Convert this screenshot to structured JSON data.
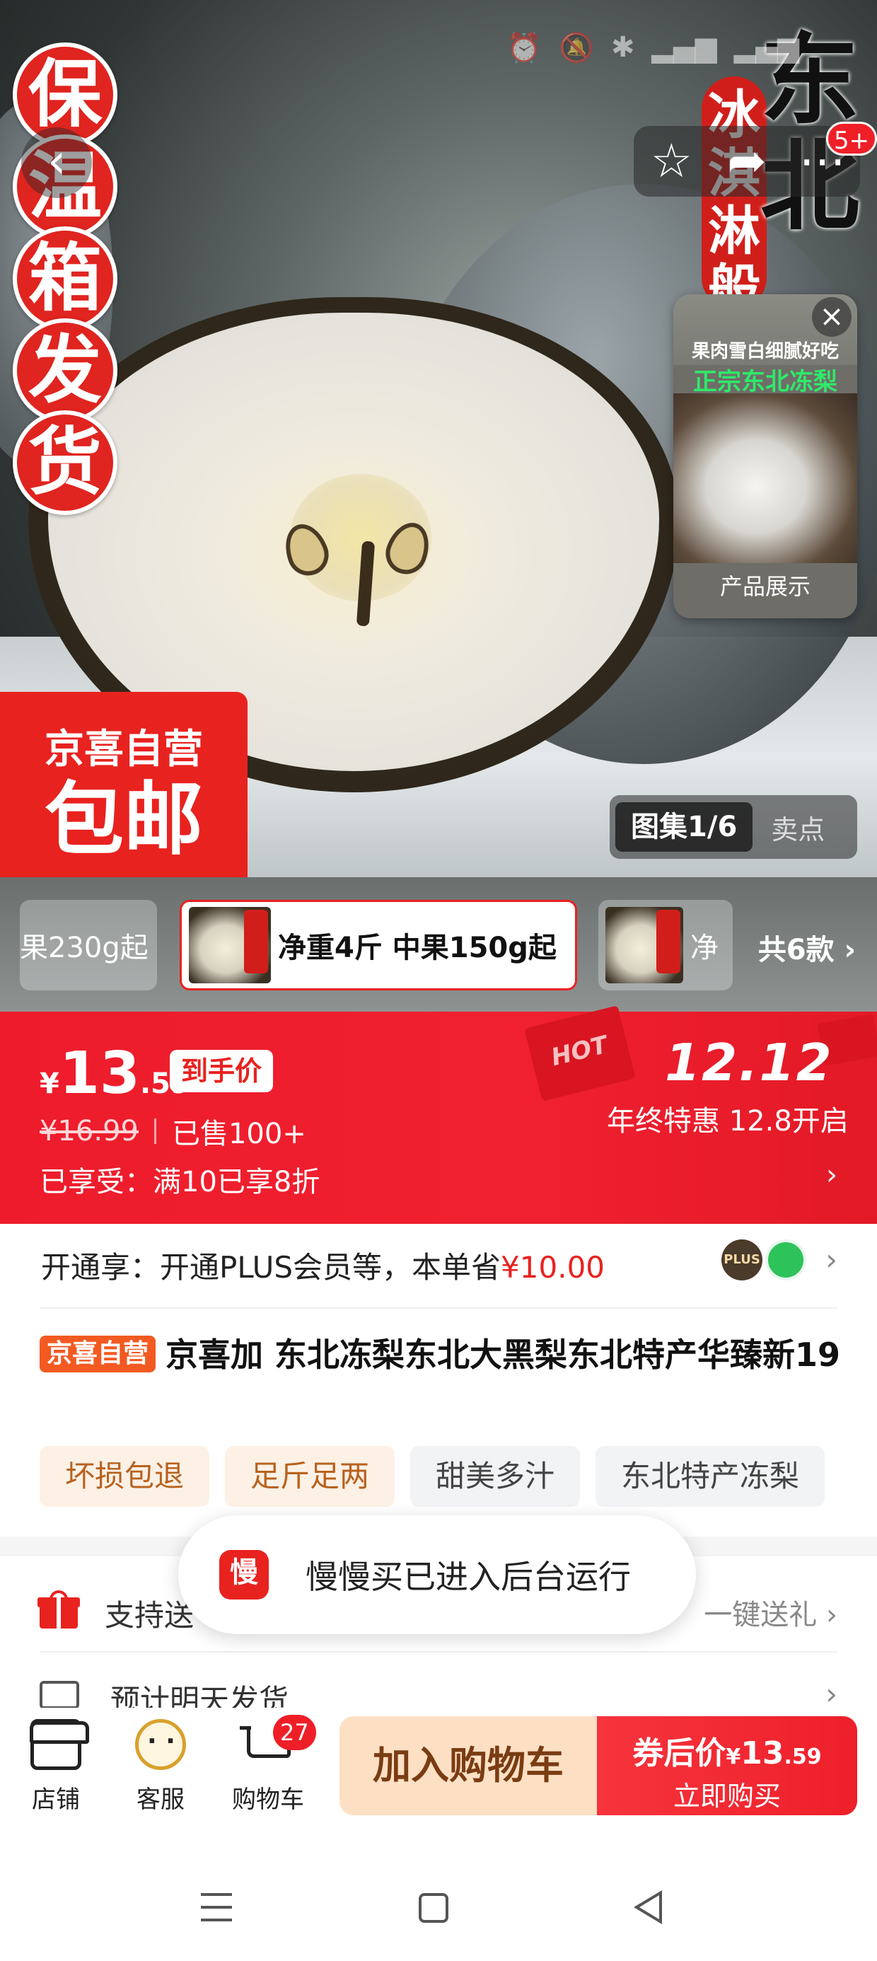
{
  "hero": {
    "badge_chars": [
      "保",
      "温",
      "箱",
      "发",
      "货"
    ],
    "title_chars": [
      "东",
      "北"
    ],
    "ribbon_chars": [
      "冰",
      "淇",
      "淋",
      "般"
    ],
    "notification_count": "5+",
    "video": {
      "overlay_line1": "果肉雪白细腻好吃",
      "overlay_line2": "正宗东北冻梨",
      "label": "产品展示"
    },
    "self_op_badge": {
      "line1": "京喜自营",
      "line2": "包邮"
    },
    "gallery_tabs": {
      "active": "图集1/6",
      "inactive": "卖点"
    }
  },
  "variants": {
    "items": [
      {
        "label": "果230g起"
      },
      {
        "label": "净重4斤 中果150g起",
        "selected": true
      },
      {
        "label": "净"
      }
    ],
    "total_label": "共6款",
    "chevron": "›"
  },
  "price": {
    "currency": "¥",
    "integer": "13",
    "decimal": ".59",
    "tag": "到手价",
    "original": "¥16.99",
    "sold": "已售100+",
    "promo": "已享受：满10已享8折",
    "promo_chevron": "›",
    "hot": "HOT",
    "event_date": "12.12",
    "event_sub": "年终特惠 12.8开启"
  },
  "plus": {
    "label": "开通享：开通PLUS会员等，本单省",
    "amount": "¥10.00",
    "plus_badge": "PLUS",
    "chevron": "›"
  },
  "product": {
    "self_tag": "京喜自营",
    "title": "京喜加 东北冻梨东北大黑梨东北特产华臻新19",
    "tags": [
      "坏损包退",
      "足斤足两",
      "甜美多汁",
      "东北特产冻梨"
    ]
  },
  "gift": {
    "label": "支持送",
    "right": "一键送礼",
    "chevron": "›"
  },
  "shipping": {
    "label": "预计明天发货",
    "chevron": "›"
  },
  "toast": {
    "logo": "慢",
    "text": "慢慢买已进入后台运行"
  },
  "bottom_bar": {
    "store": "店铺",
    "service": "客服",
    "cart": "购物车",
    "cart_count": "27",
    "add_cart": "加入购物车",
    "buy_line1_prefix": "券后价",
    "buy_currency": "¥",
    "buy_int": "13",
    "buy_dec": ".59",
    "buy_line2": "立即购买"
  },
  "colors": {
    "brand_red": "#ee1c2b",
    "cart_button_bg": "#fde0c4",
    "tag_warm_bg": "#fdf1e6",
    "tag_cool_bg": "#f2f3f5"
  }
}
